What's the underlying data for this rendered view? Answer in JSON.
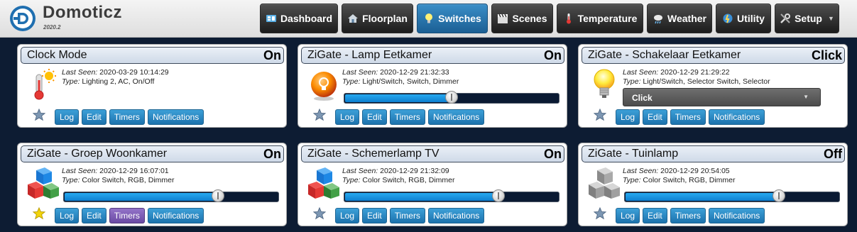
{
  "app": {
    "name": "Domoticz",
    "version": "2020.2"
  },
  "nav": [
    {
      "label": "Dashboard",
      "icon": "dashboard-icon",
      "active": false
    },
    {
      "label": "Floorplan",
      "icon": "house-icon",
      "active": false
    },
    {
      "label": "Switches",
      "icon": "bulb-icon",
      "active": true
    },
    {
      "label": "Scenes",
      "icon": "clapperboard-icon",
      "active": false
    },
    {
      "label": "Temperature",
      "icon": "thermometer-icon",
      "active": false
    },
    {
      "label": "Weather",
      "icon": "weather-icon",
      "active": false
    },
    {
      "label": "Utility",
      "icon": "utility-icon",
      "active": false
    },
    {
      "label": "Setup",
      "icon": "tools-icon",
      "active": false
    }
  ],
  "labels": {
    "last_seen": "Last Seen:",
    "type": "Type:"
  },
  "buttons": {
    "log": "Log",
    "edit": "Edit",
    "timers": "Timers",
    "notifications": "Notifications"
  },
  "colors": {
    "active_nav": "#2a7ab8",
    "button": "#2a86c2",
    "timers_active": "#7b5bb5",
    "background": "#0d1c33",
    "favorite": "#f2d40b"
  },
  "devices": [
    {
      "name": "Clock Mode",
      "status": "On",
      "last_seen": "2020-03-29 10:14:29",
      "type": "Lighting 2, AC, On/Off",
      "icon": "thermometer-sun-icon",
      "favorite": false,
      "timers_active": false
    },
    {
      "name": "ZiGate - Lamp Eetkamer",
      "status": "On",
      "last_seen": "2020-12-29 21:32:33",
      "type": "Light/Switch, Switch, Dimmer",
      "icon": "bulb-orb-icon",
      "level_percent": 50,
      "favorite": false,
      "timers_active": false
    },
    {
      "name": "ZiGate - Schakelaar Eetkamer",
      "status": "Click",
      "last_seen": "2020-12-29 21:29:22",
      "type": "Light/Switch, Selector Switch, Selector",
      "icon": "lightbulb-icon",
      "selector_value": "Click",
      "favorite": false,
      "timers_active": false
    },
    {
      "name": "ZiGate - Groep Woonkamer",
      "status": "On",
      "last_seen": "2020-12-29 16:07:01",
      "type": "Color Switch, RGB, Dimmer",
      "icon": "rgb-cubes-icon",
      "level_percent": 72,
      "favorite": true,
      "timers_active": true
    },
    {
      "name": "ZiGate - Schemerlamp TV",
      "status": "On",
      "last_seen": "2020-12-29 21:32:09",
      "type": "Color Switch, RGB, Dimmer",
      "icon": "rgb-cubes-icon",
      "level_percent": 72,
      "favorite": false,
      "timers_active": false
    },
    {
      "name": "ZiGate - Tuinlamp",
      "status": "Off",
      "last_seen": "2020-12-29 20:54:05",
      "type": "Color Switch, RGB, Dimmer",
      "icon": "grey-cubes-icon",
      "level_percent": 72,
      "favorite": false,
      "timers_active": false
    }
  ]
}
